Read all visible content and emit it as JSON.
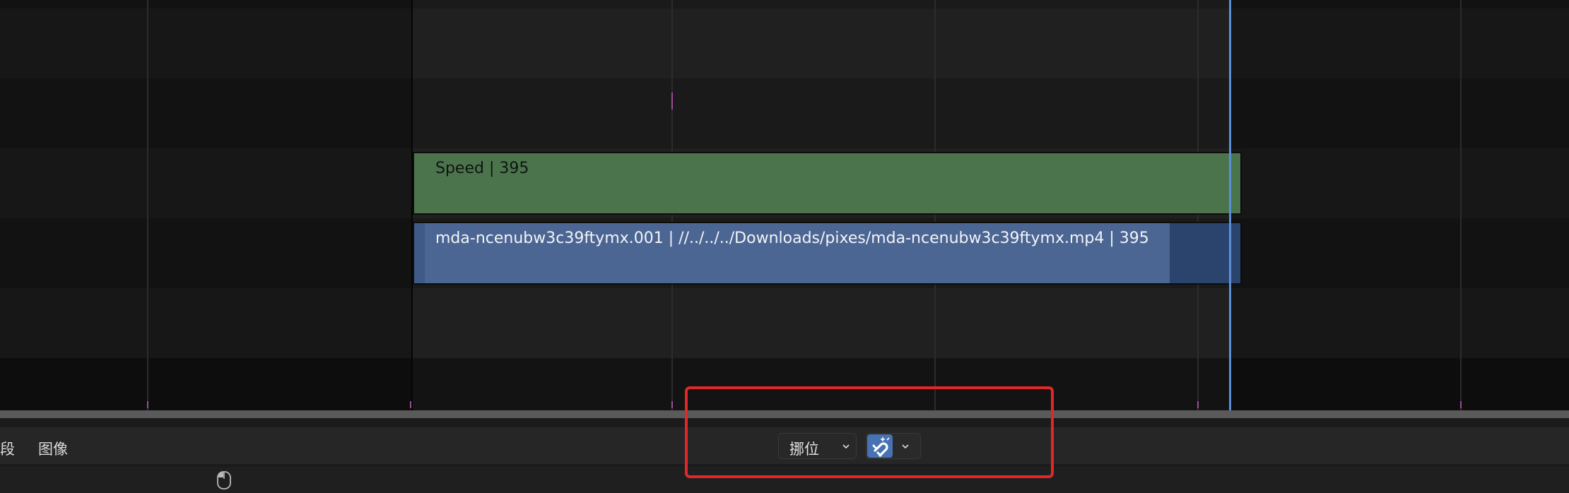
{
  "strips": {
    "speed_label": "Speed | 395",
    "movie_label": "mda-ncenubw3c39ftymx.001 | //../../../Downloads/pixes/mda-ncenubw3c39ftymx.mp4 | 395"
  },
  "header": {
    "menu_items": [
      "段",
      "图像"
    ],
    "overlap_mode": "挪位",
    "snap_active": true
  },
  "colors": {
    "speed_strip": "#4b744d",
    "movie_strip": "#4c6693",
    "playhead": "#5c8ed8",
    "snap_active": "#4772b3",
    "highlight_box": "#e02828"
  },
  "icons": {
    "snap": "magnet-icon",
    "dropdown": "chevron-down-icon",
    "status_mouse": "mouse-icon"
  }
}
